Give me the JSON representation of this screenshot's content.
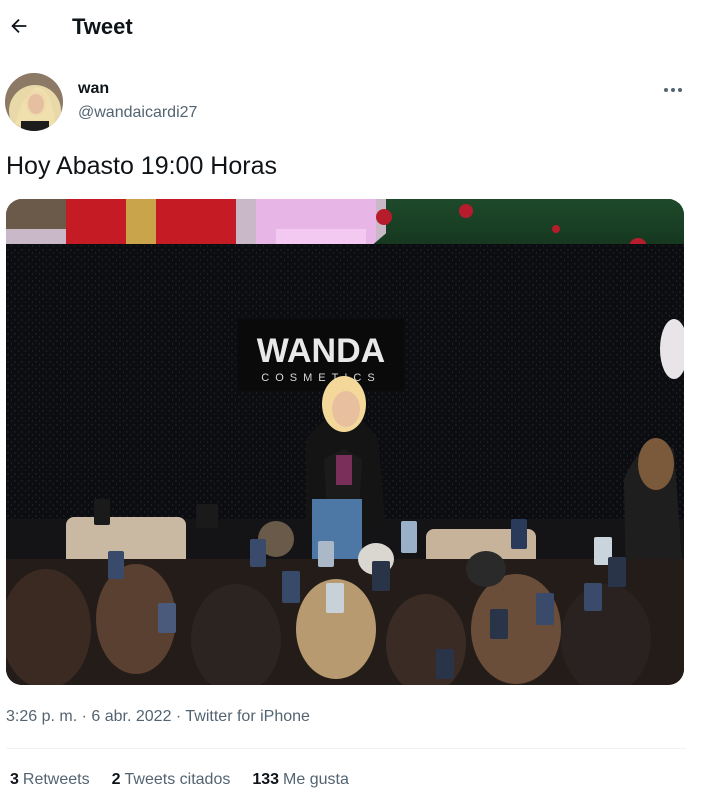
{
  "header": {
    "title": "Tweet",
    "back_icon": "arrow-left-icon"
  },
  "author": {
    "name": "wan",
    "handle": "@wandaicardi27",
    "more_icon": "more-dots-icon"
  },
  "tweet": {
    "text": "Hoy Abasto 19:00 Horas"
  },
  "media": {
    "banner_brand": "WANDA",
    "banner_sub": "COSMETICS"
  },
  "meta": {
    "time": "3:26 p. m.",
    "separator": "·",
    "date": "6 abr. 2022",
    "source": "Twitter for iPhone"
  },
  "stats": [
    {
      "count": "3",
      "label": "Retweets"
    },
    {
      "count": "2",
      "label": "Tweets citados"
    },
    {
      "count": "133",
      "label": "Me gusta"
    }
  ],
  "colors": {
    "text": "#0f1419",
    "secondary": "#536471",
    "divider": "#eff3f4"
  }
}
